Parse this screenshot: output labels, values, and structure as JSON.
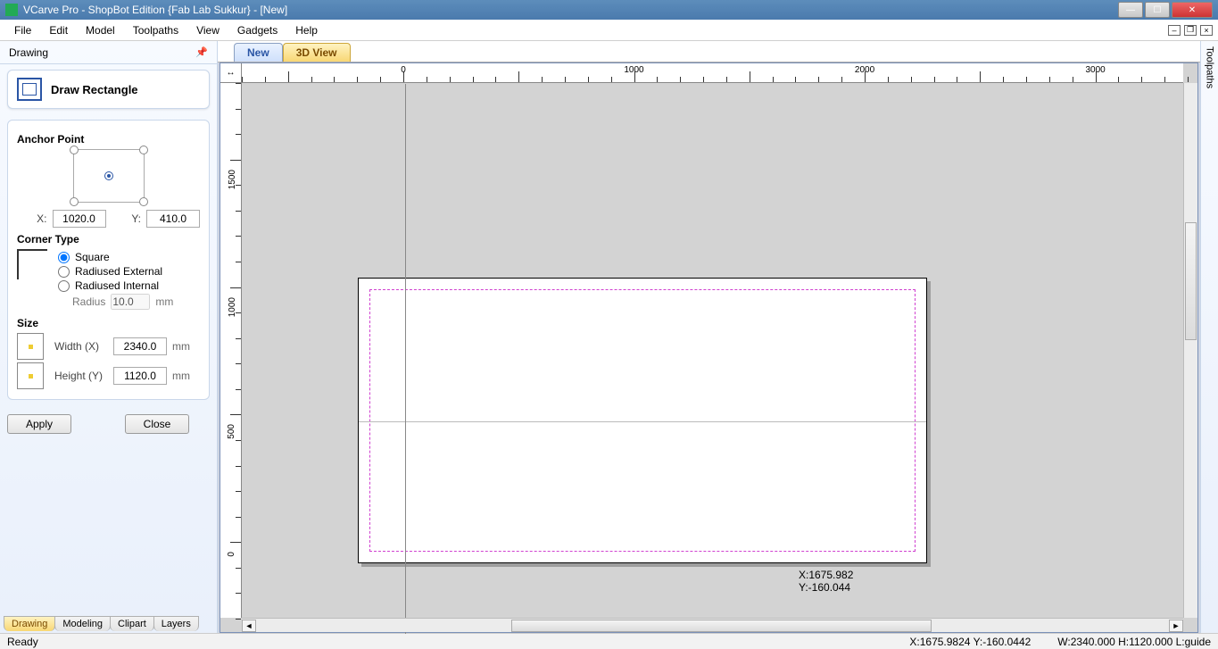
{
  "window": {
    "title": "VCarve Pro - ShopBot Edition {Fab Lab Sukkur} - [New]"
  },
  "menu": [
    "File",
    "Edit",
    "Model",
    "Toolpaths",
    "View",
    "Gadgets",
    "Help"
  ],
  "panel": {
    "title": "Drawing",
    "tool_title": "Draw Rectangle",
    "anchor_label": "Anchor Point",
    "x_label": "X:",
    "y_label": "Y:",
    "x_value": "1020.0",
    "y_value": "410.0",
    "corner_label": "Corner Type",
    "corner_square": "Square",
    "corner_ext": "Radiused External",
    "corner_int": "Radiused Internal",
    "radius_label": "Radius",
    "radius_value": "10.0",
    "radius_unit": "mm",
    "size_label": "Size",
    "width_label": "Width (X)",
    "width_value": "2340.0",
    "width_unit": "mm",
    "height_label": "Height (Y)",
    "height_value": "1120.0",
    "height_unit": "mm",
    "apply": "Apply",
    "close": "Close",
    "tabs": [
      "Drawing",
      "Modeling",
      "Clipart",
      "Layers"
    ]
  },
  "view_tabs": [
    "New",
    "3D View"
  ],
  "ruler": {
    "h_majors": [
      0,
      1000,
      2000,
      3000
    ],
    "v_majors": [
      0,
      500,
      1000,
      1500
    ]
  },
  "cursor": {
    "x_label": "X:1675.982",
    "y_label": "Y:-160.044"
  },
  "right_panel": "Toolpaths",
  "status": {
    "ready": "Ready",
    "xy": "X:1675.9824 Y:-160.0442",
    "dims": "W:2340.000   H:1120.000  L:guide"
  }
}
